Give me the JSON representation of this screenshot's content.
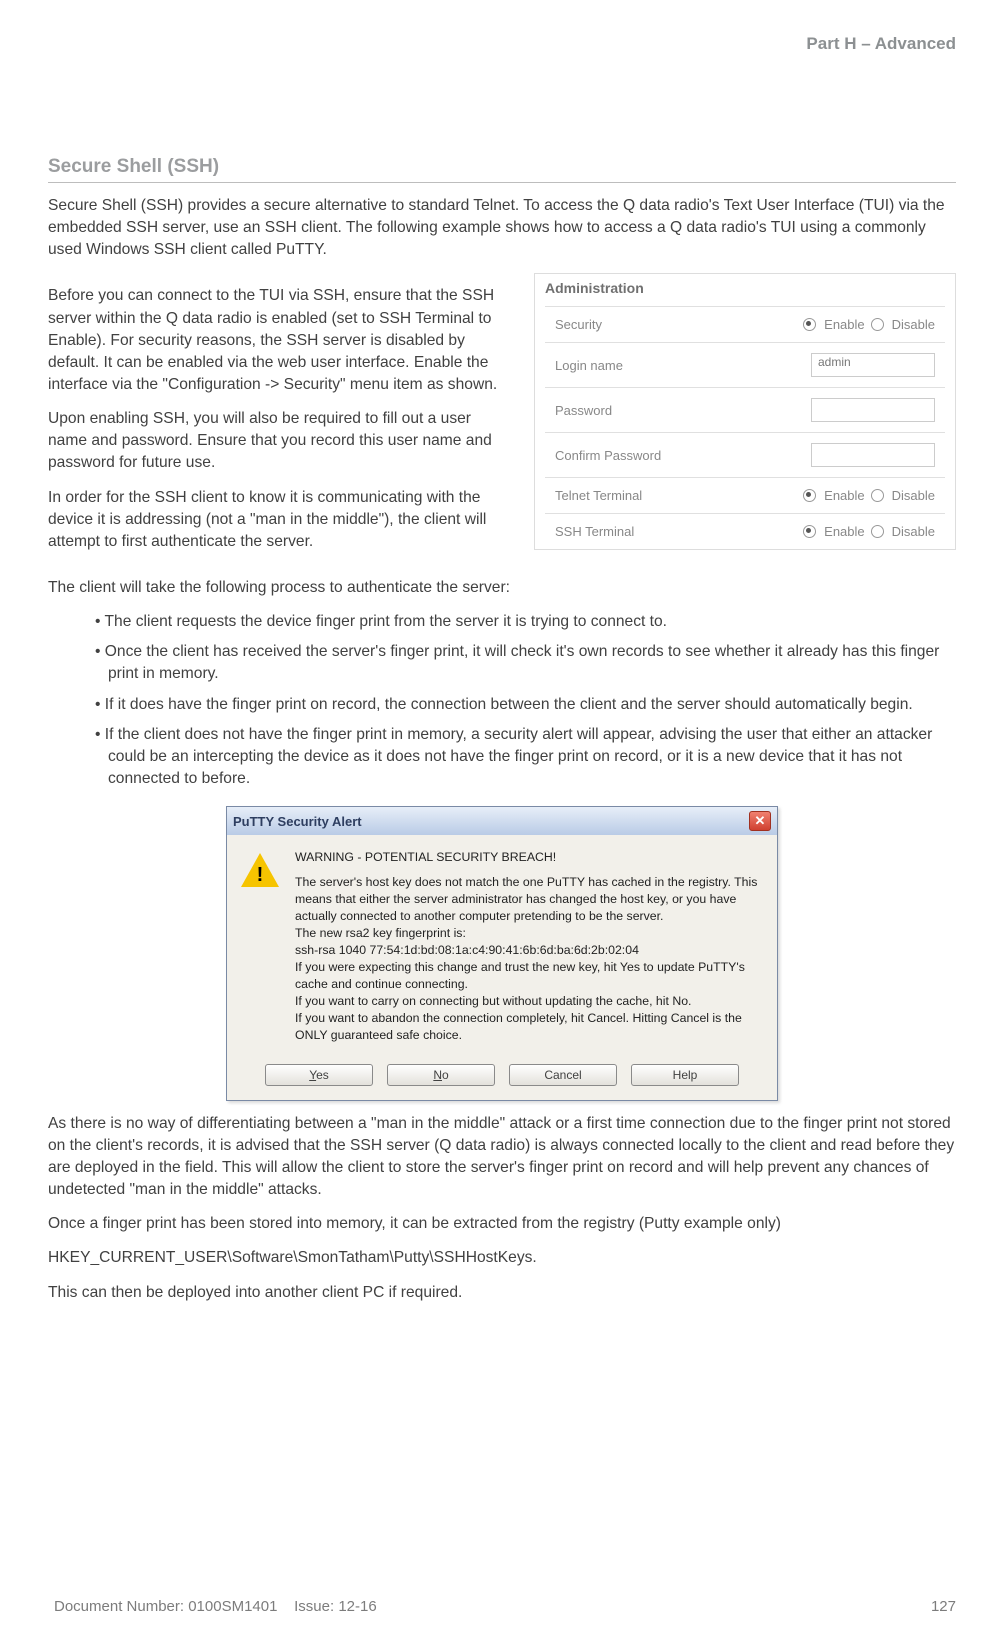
{
  "header": {
    "part": "Part H – Advanced"
  },
  "section_title": "Secure Shell (SSH)",
  "intro": "Secure Shell (SSH) provides a secure alternative to standard Telnet. To access the Q data radio's Text User Interface (TUI) via the embedded SSH server, use an SSH client. The following example shows how to access a Q data radio's TUI using a commonly used Windows SSH client called PuTTY.",
  "p2": "Before you can connect to the TUI via SSH, ensure that the SSH server within the Q data radio is enabled (set to SSH Terminal to Enable). For security reasons, the SSH server is disabled by default. It can be enabled via the web user interface. Enable the interface via the \"Configuration -> Security\" menu item as shown.",
  "p3": "Upon enabling SSH, you will also be required to fill out a user name and password. Ensure that you record this user name and password for future use.",
  "p4": "In order for the SSH client to know it is communicating with the device it is addressing (not a \"man in the middle\"), the client will attempt to first authenticate the server.",
  "admin": {
    "title": "Administration",
    "security": "Security",
    "login_name": "Login name",
    "login_value": "admin",
    "password": "Password",
    "confirm_password": "Confirm Password",
    "telnet": "Telnet Terminal",
    "ssh": "SSH Terminal",
    "enable": "Enable",
    "disable": "Disable"
  },
  "p5": "The client will take the following process to authenticate the server:",
  "bullets": [
    "The client requests the device finger print from the server it is trying to connect to.",
    "Once the client has received the server's finger print, it will check it's own records to see whether it already has this finger print in memory.",
    "If it does have the finger print on record, the connection between the client and the server should automatically begin.",
    "If the client does not have the finger print in memory, a security alert will appear, advising the user that either an attacker could be an intercepting the device as it does not have the finger print on record, or it is a new device that it has not connected to before."
  ],
  "dialog": {
    "title": "PuTTY Security Alert",
    "l1": "WARNING - POTENTIAL SECURITY BREACH!",
    "l2": "The server's host key does not match the one PuTTY has cached in the registry. This means that either the server administrator has changed the host key, or you have actually connected to another computer pretending to be the server.",
    "l3": "The new rsa2 key fingerprint is:",
    "l4": "ssh-rsa 1040 77:54:1d:bd:08:1a:c4:90:41:6b:6d:ba:6d:2b:02:04",
    "l5": "If you were expecting this change and trust the new key, hit Yes to update PuTTY's cache and continue connecting.",
    "l6": "If you want to carry on connecting but without updating the cache, hit No.",
    "l7": "If you want to abandon the connection completely, hit Cancel. Hitting Cancel is the ONLY guaranteed safe choice.",
    "yes": "Yes",
    "no": "No",
    "cancel": "Cancel",
    "help": "Help"
  },
  "p6": "As there is no way of differentiating between a \"man in the middle\" attack or a first time connection due to the finger print not stored on the client's records, it is advised that the SSH server (Q data radio) is always connected locally to the client and read before they are deployed in the field. This will allow the client to store the server's finger print on record and will help prevent any chances of undetected \"man in the middle\" attacks.",
  "p7": "Once a finger print has been stored into memory, it can be extracted from the registry (Putty example only)",
  "p8": "HKEY_CURRENT_USER\\Software\\SmonTatham\\Putty\\SSHHostKeys.",
  "p9": "This can then be deployed into another client PC if required.",
  "footer": {
    "docnum": "Document Number: 0100SM1401",
    "issue": "Issue: 12-16",
    "page": "127"
  }
}
